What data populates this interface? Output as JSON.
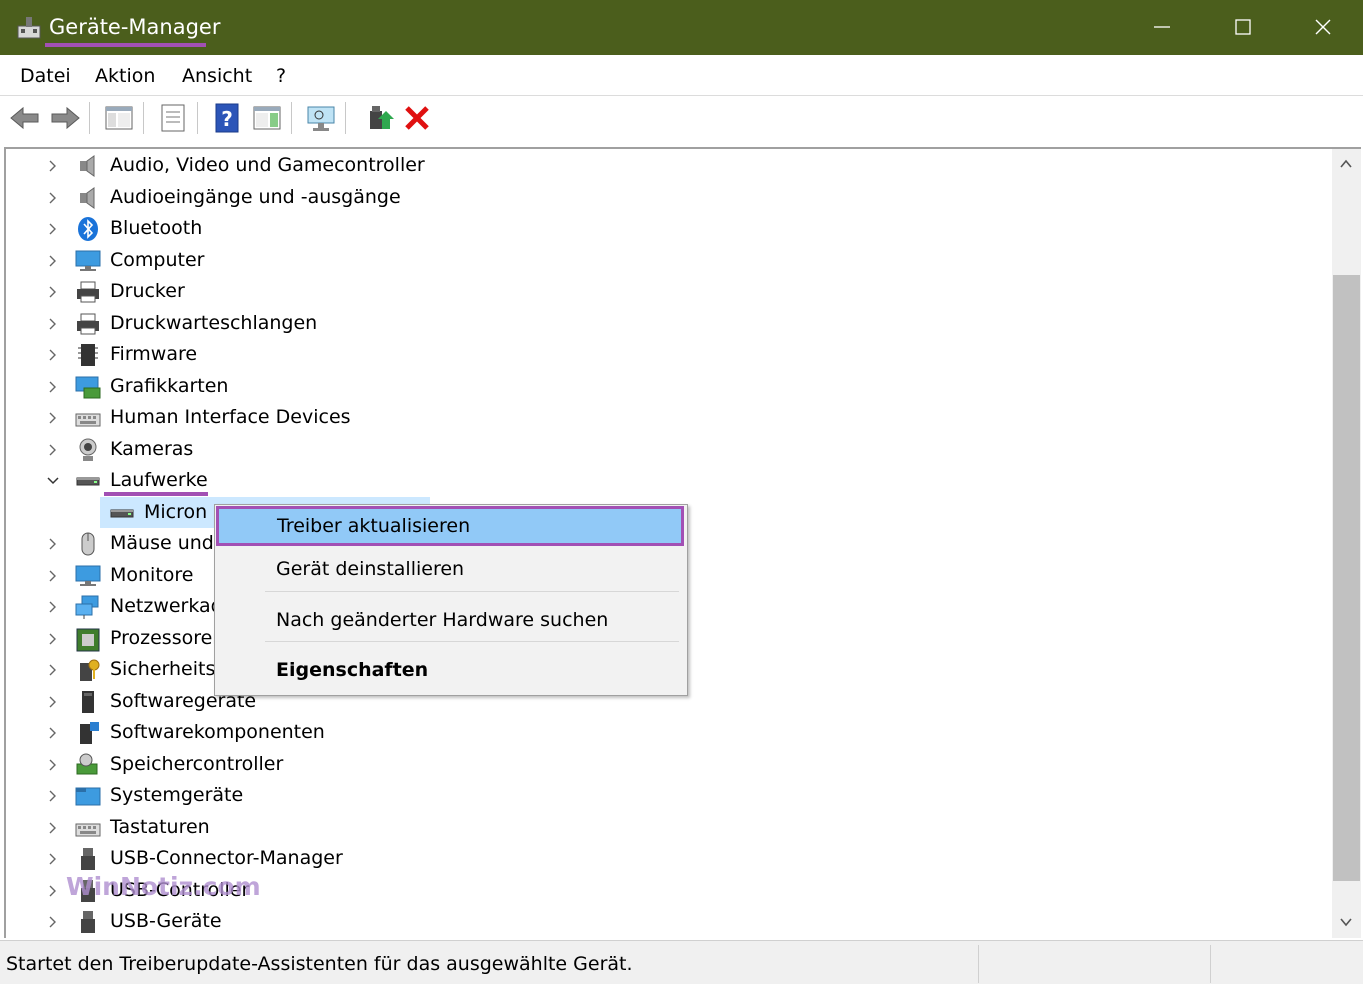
{
  "window": {
    "title": "Geräte-Manager",
    "titlebar_color": "#4b5e1c",
    "highlight_color": "#a250b4",
    "controls": [
      "minimize-icon",
      "maximize-icon",
      "close-icon"
    ]
  },
  "menu": {
    "items": [
      "Datei",
      "Aktion",
      "Ansicht",
      "?"
    ]
  },
  "toolbar": {
    "buttons": [
      "back-arrow-icon",
      "forward-arrow-icon",
      "show-hide-console-tree-icon",
      "properties-icon",
      "help-icon",
      "action-pane-icon",
      "scan-hardware-icon",
      "update-driver-icon",
      "uninstall-device-icon"
    ]
  },
  "tree": {
    "rows": [
      {
        "label": "Audio, Video und Gamecontroller",
        "icon": "speaker-icon"
      },
      {
        "label": "Audioeingänge und -ausgänge",
        "icon": "speaker-icon"
      },
      {
        "label": "Bluetooth",
        "icon": "bluetooth-icon"
      },
      {
        "label": "Computer",
        "icon": "monitor-icon"
      },
      {
        "label": "Drucker",
        "icon": "printer-icon"
      },
      {
        "label": "Druckwarteschlangen",
        "icon": "printer-icon"
      },
      {
        "label": "Firmware",
        "icon": "chip-icon"
      },
      {
        "label": "Grafikkarten",
        "icon": "display-adapter-icon"
      },
      {
        "label": "Human Interface Devices",
        "icon": "keyboard-icon"
      },
      {
        "label": "Kameras",
        "icon": "webcam-icon"
      },
      {
        "label": "Laufwerke",
        "icon": "drive-icon",
        "expanded": true
      },
      {
        "label": "Micron",
        "icon": "drive-icon",
        "child": true,
        "selected": true
      },
      {
        "label": "Mäuse und",
        "icon": "mouse-icon"
      },
      {
        "label": "Monitore",
        "icon": "monitor-icon"
      },
      {
        "label": "Netzwerkad",
        "icon": "network-icon"
      },
      {
        "label": "Prozessoren",
        "icon": "cpu-icon"
      },
      {
        "label": "Sicherheits",
        "icon": "security-key-icon"
      },
      {
        "label": "Softwaregeräte",
        "icon": "software-device-icon"
      },
      {
        "label": "Softwarekomponenten",
        "icon": "software-component-icon"
      },
      {
        "label": "Speichercontroller",
        "icon": "storage-controller-icon"
      },
      {
        "label": "Systemgeräte",
        "icon": "system-folder-icon"
      },
      {
        "label": "Tastaturen",
        "icon": "keyboard-icon"
      },
      {
        "label": "USB-Connector-Manager",
        "icon": "usb-icon"
      },
      {
        "label": "USB-Controller",
        "icon": "usb-icon"
      },
      {
        "label": "USB-Geräte",
        "icon": "usb-icon"
      }
    ]
  },
  "context_menu": {
    "items": [
      {
        "label": "Treiber aktualisieren",
        "highlighted": true
      },
      {
        "label": "Gerät deinstallieren"
      },
      {
        "label": "Nach geänderter Hardware suchen"
      },
      {
        "label": "Eigenschaften",
        "bold": true
      }
    ]
  },
  "watermark": "WinNotiz.com",
  "status": {
    "text": "Startet den Treiberupdate-Assistenten für das ausgewählte Gerät."
  }
}
